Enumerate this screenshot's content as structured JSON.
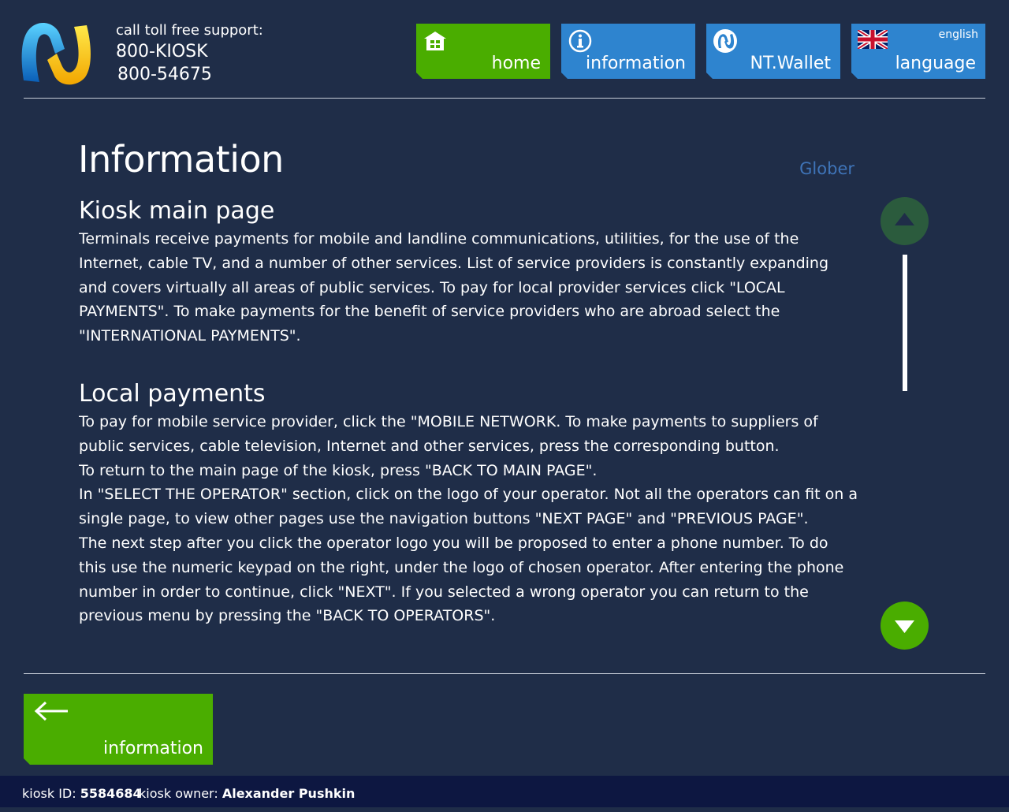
{
  "header": {
    "support_label": "call toll free support:",
    "phone_1": "800-KIOSK",
    "phone_2": "800-54675"
  },
  "nav": {
    "home": {
      "label": "home",
      "icon": "house-icon",
      "color": "#4aad00"
    },
    "information": {
      "label": "information",
      "icon": "info-icon",
      "color": "#2e84cf"
    },
    "wallet": {
      "label": "NT.Wallet",
      "icon": "nt-wallet-icon",
      "color": "#2e84cf"
    },
    "language": {
      "label": "language",
      "current": "english",
      "icon": "uk-flag-icon",
      "color": "#2e84cf"
    }
  },
  "page": {
    "title": "Information",
    "brand": "Glober"
  },
  "sections": [
    {
      "heading": "Kiosk main page",
      "paragraphs": [
        "Terminals receive payments for mobile and landline communications, utilities, for the use of the Internet, cable TV, and a number of other services. List of service providers is constantly expanding and covers virtually all areas of public services. To pay for local provider services click \"LOCAL PAYMENTS\".  To make payments for the benefit of service providers who are abroad select the \"INTERNATIONAL PAYMENTS\"."
      ]
    },
    {
      "heading": "Local payments",
      "paragraphs": [
        "To pay for mobile service provider, click the \"MOBILE NETWORK.  To make payments to suppliers of public services, cable television, Internet and other services, press the corresponding button.",
        "To return to the main page of the kiosk, press \"BACK TO MAIN PAGE\".",
        "In \"SELECT THE OPERATOR\" section, click on the logo of your operator. Not all the operators can fit on a single page, to view other pages use the navigation buttons \"NEXT PAGE\" and \"PREVIOUS PAGE\".",
        "The next step after you click the operator logo you will be proposed to enter a phone number. To do this use the numeric keypad on the right, under the logo of chosen operator. After entering the phone number in order to continue, click \"NEXT\". If you selected a wrong operator you can return to the previous menu by pressing the \"BACK TO OPERATORS\"."
      ]
    }
  ],
  "scroll": {
    "up_icon": "triangle-up-icon",
    "down_icon": "triangle-down-icon"
  },
  "back_button": {
    "label": "information",
    "icon": "arrow-left-icon"
  },
  "footer": {
    "kiosk_id_label": "kiosk ID:",
    "kiosk_id": "5584684",
    "owner_label": "kiosk owner:",
    "owner": "Alexander Pushkin"
  }
}
